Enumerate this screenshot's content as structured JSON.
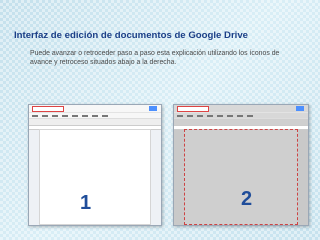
{
  "slide": {
    "title": "Interfaz de edición de documentos de Google Drive",
    "description": "Puede avanzar o retroceder paso a paso esta explicación utilizando los íconos de avance y retroceso situados abajo a la derecha."
  },
  "screenshots": [
    {
      "label": "1"
    },
    {
      "label": "2"
    }
  ]
}
